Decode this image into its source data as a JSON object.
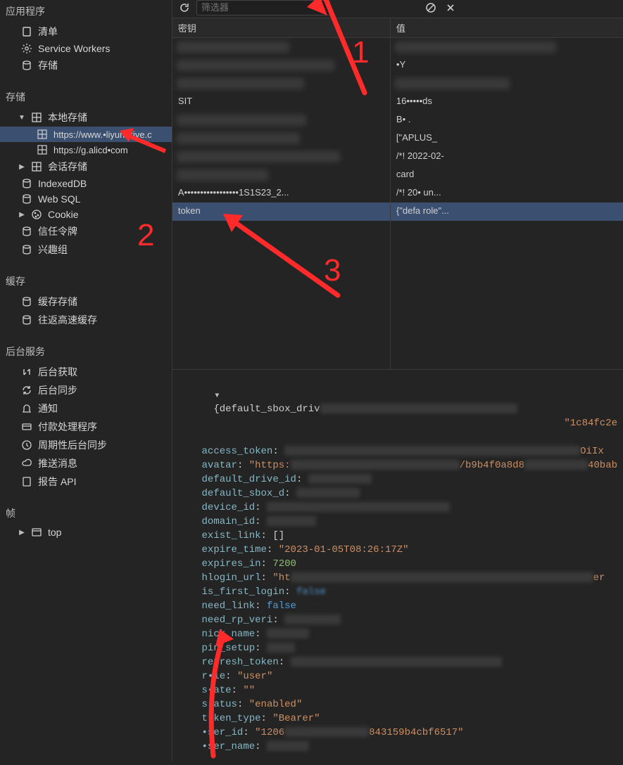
{
  "sidebar": {
    "section_app": "应用程序",
    "app_items": [
      {
        "label": "清单",
        "icon": "file-icon"
      },
      {
        "label": "Service Workers",
        "icon": "gear-icon"
      },
      {
        "label": "存储",
        "icon": "db-icon"
      }
    ],
    "section_storage": "存储",
    "storage_items": {
      "local_storage": "本地存储",
      "local_origins": [
        "https://www.•liyundrive.c",
        "https://g.alicd•com"
      ],
      "session_storage": "会话存储",
      "indexeddb": "IndexedDB",
      "websql": "Web SQL",
      "cookie": "Cookie",
      "trust_tokens": "信任令牌",
      "interest_groups": "兴趣组"
    },
    "section_cache": "缓存",
    "cache_items": [
      {
        "label": "缓存存储",
        "icon": "db-icon"
      },
      {
        "label": "往返高速缓存",
        "icon": "db-icon"
      }
    ],
    "section_bgservices": "后台服务",
    "bg_items": [
      {
        "label": "后台获取",
        "icon": "sync-icon"
      },
      {
        "label": "后台同步",
        "icon": "refresh-icon"
      },
      {
        "label": "通知",
        "icon": "bell-icon"
      },
      {
        "label": "付款处理程序",
        "icon": "card-icon"
      },
      {
        "label": "周期性后台同步",
        "icon": "clock-icon"
      },
      {
        "label": "推送消息",
        "icon": "cloud-icon"
      },
      {
        "label": "报告 API",
        "icon": "file-icon"
      }
    ],
    "section_frames": "帧",
    "frame_top": "top"
  },
  "toolbar": {
    "filter_placeholder": "筛选器"
  },
  "table": {
    "keys_header": "密钥",
    "vals_header": "值",
    "rows": [
      {
        "key": "",
        "val": ""
      },
      {
        "key": "",
        "val": "•Y"
      },
      {
        "key": "",
        "val": ""
      },
      {
        "key": "SIT",
        "val": "16•••••ds"
      },
      {
        "key": "",
        "val": "B•                                                      ."
      },
      {
        "key": "",
        "val": "[\"APLUS_"
      },
      {
        "key": "",
        "val": "/*! 2022-02-"
      },
      {
        "key": "",
        "val": "card"
      },
      {
        "key": "A•••••••••••••••••1S1S23_2...",
        "val": "/*! 20•                                                   un..."
      },
      {
        "key": "token",
        "val": "{\"defa                                              role\"..."
      }
    ]
  },
  "detail": {
    "header": "{default_sbox_driv",
    "header_right": "\"1c84fc2e",
    "lines": [
      {
        "key": "access_token",
        "obscure": 420,
        "suffix": "OiIx"
      },
      {
        "key": "avatar",
        "str_prefix": "\"https:",
        "obscure": 240,
        "mid": "/b9b4f0a8d8",
        "obscure2": 90,
        "suffix": "40bab"
      },
      {
        "key": "default_drive_id",
        "obscure": 90
      },
      {
        "key": "default_sbox_d",
        "obscure": 90
      },
      {
        "key": "device_id",
        "obscure": 260
      },
      {
        "key": "domain_id",
        "obscure": 70
      },
      {
        "key": "exist_link",
        "raw": "[]"
      },
      {
        "key": "expire_time",
        "str": "\"2023-01-05T08:26:17Z\""
      },
      {
        "key": "expires_in",
        "num": "7200"
      },
      {
        "key": "hlogin_url",
        "str_prefix": "\"ht",
        "obscure": 430,
        "suffix": "er"
      },
      {
        "key": "is_first_login",
        "bool_blur": "false"
      },
      {
        "key": "need_link",
        "bool": "false"
      },
      {
        "key": "need_rp_veri",
        "obscure": 80
      },
      {
        "key": "nick_name",
        "obscure": 60
      },
      {
        "key": "pin_setup",
        "obscure": 40
      },
      {
        "key": "refresh_token",
        "obscure": 300
      },
      {
        "key": "r•le",
        "str": "\"user\""
      },
      {
        "key": "s•ate",
        "str": "\"\""
      },
      {
        "key": "s•atus",
        "str": "\"enabled\""
      },
      {
        "key": "t•ken_type",
        "str": "\"Bearer\""
      },
      {
        "key": "•ser_id",
        "str_prefix": "\"1206",
        "obscure": 120,
        "suffix": "843159b4cbf6517\""
      },
      {
        "key": "•ser_name",
        "obscure": 60
      }
    ]
  }
}
